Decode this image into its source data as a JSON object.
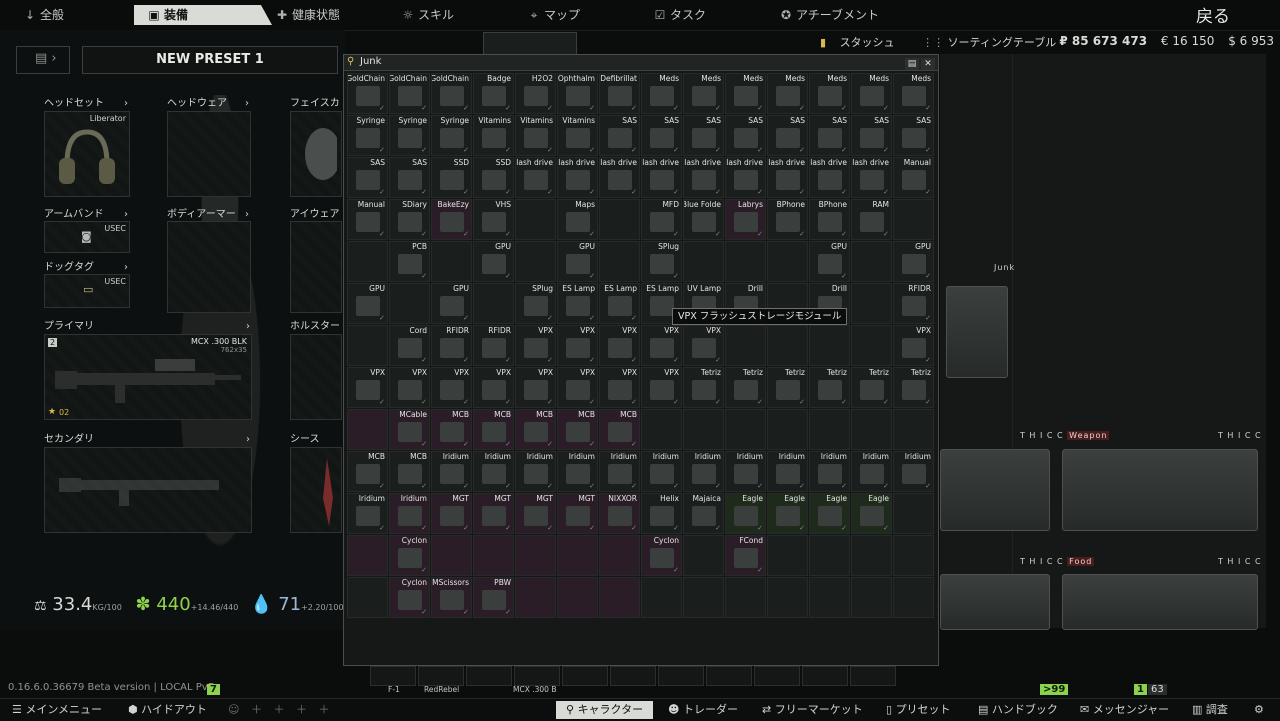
{
  "nav": {
    "tabs": [
      {
        "icon": "↓",
        "label": "全般"
      },
      {
        "icon": "▣",
        "label": "装備"
      },
      {
        "icon": "✚",
        "label": "健康状態"
      },
      {
        "icon": "☼",
        "label": "スキル"
      },
      {
        "icon": "⌖",
        "label": "マップ"
      },
      {
        "icon": "☑",
        "label": "タスク"
      },
      {
        "icon": "✪",
        "label": "アチーブメント"
      }
    ],
    "back": "戻る"
  },
  "sub_tabs": [
    "スタッシュ",
    "ソーティングテーブル"
  ],
  "currency": {
    "rub": "₽ 85 673 473",
    "eur": "€ 16 150",
    "usd": "$ 6 953"
  },
  "preset": {
    "name": "NEW PRESET 1"
  },
  "slots": {
    "headset": {
      "label": "ヘッドセット",
      "tag": "Liberator"
    },
    "headwear": {
      "label": "ヘッドウェア"
    },
    "facecover": {
      "label": "フェイスカ"
    },
    "armband": {
      "label": "アームバンド",
      "tag": "USEC"
    },
    "armor": {
      "label": "ボディアーマー"
    },
    "eyewear": {
      "label": "アイウェア"
    },
    "dogtag": {
      "label": "ドッグタグ",
      "tag": "USEC"
    },
    "primary": {
      "label": "プライマリ",
      "weapon": "MCX .300 BLK",
      "ammo": "762x35",
      "num": "2",
      "level": "02"
    },
    "holster": {
      "label": "ホルスター"
    },
    "secondary": {
      "label": "セカンダリ"
    },
    "scabbard": {
      "label": "シース"
    }
  },
  "stats": {
    "weight": "33.4",
    "weight_unit": "KG",
    "weight_max": "/100",
    "energy": "440",
    "energy_rate": "+14.46",
    "energy_max": "/440",
    "hydration": "71",
    "hydration_rate": "+2.20",
    "hydration_max": "/100",
    "stamina": "04"
  },
  "junk": {
    "title": "Junk",
    "rows": [
      [
        "GoldChain",
        "GoldChain",
        "GoldChain",
        "Badge",
        "H2O2",
        "Ophthalm",
        "Defibrillat",
        "Meds",
        "Meds",
        "Meds",
        "Meds",
        "Meds",
        "Meds",
        "Meds"
      ],
      [
        "Syringe",
        "Syringe",
        "Syringe",
        "Vitamins",
        "Vitamins",
        "Vitamins",
        "SAS",
        "SAS",
        "SAS",
        "SAS",
        "SAS",
        "SAS",
        "SAS",
        "SAS"
      ],
      [
        "SAS",
        "SAS",
        "SSD",
        "SSD",
        "Flash drive",
        "Flash drive",
        "Flash drive",
        "Flash drive",
        "Flash drive",
        "Flash drive",
        "Flash drive",
        "Flash drive",
        "Flash drive",
        "Manual"
      ],
      [
        "Manual",
        "SDiary",
        "BakeEzy",
        "VHS",
        "",
        "Maps",
        "",
        "MFD",
        "Blue Folde",
        "Labrys",
        "BPhone",
        "BPhone",
        "RAM",
        ""
      ],
      [
        "",
        "PCB",
        "",
        "GPU",
        "",
        "GPU",
        "",
        "SPlug",
        "",
        "",
        "",
        "GPU",
        "",
        "GPU"
      ],
      [
        "GPU",
        "",
        "GPU",
        "",
        "SPlug",
        "ES Lamp",
        "ES Lamp",
        "ES Lamp",
        "UV Lamp",
        "Drill",
        "",
        "Drill",
        "",
        "RFIDR"
      ],
      [
        "",
        "Cord",
        "RFIDR",
        "RFIDR",
        "VPX",
        "VPX",
        "VPX",
        "VPX",
        "VPX",
        "",
        "",
        "",
        "",
        "VPX"
      ],
      [
        "VPX",
        "VPX",
        "VPX",
        "VPX",
        "VPX",
        "VPX",
        "VPX",
        "VPX",
        "Tetriz",
        "Tetriz",
        "Tetriz",
        "Tetriz",
        "Tetriz",
        "Tetriz"
      ],
      [
        "",
        "MCable",
        "MCB",
        "MCB",
        "MCB",
        "MCB",
        "MCB",
        "",
        "",
        "",
        "",
        "",
        "",
        ""
      ],
      [
        "MCB",
        "MCB",
        "Iridium",
        "Iridium",
        "Iridium",
        "Iridium",
        "Iridium",
        "Iridium",
        "Iridium",
        "Iridium",
        "Iridium",
        "Iridium",
        "Iridium",
        "Iridium"
      ],
      [
        "Iridium",
        "Iridium",
        "MGT",
        "MGT",
        "MGT",
        "MGT",
        "NIXXOR",
        "Helix",
        "Majaica",
        "Eagle",
        "Eagle",
        "Eagle",
        "Eagle",
        ""
      ],
      [
        "",
        "Cyclon",
        "",
        "",
        "",
        "",
        "",
        "Cyclon",
        "",
        "FCond",
        "",
        "",
        "",
        ""
      ],
      [
        "",
        "Cyclon",
        "MScissors",
        "PBW",
        "",
        "",
        "",
        "",
        "",
        "",
        "",
        "",
        "",
        ""
      ]
    ]
  },
  "tooltip": "VPX フラッシュストレージモジュール",
  "stash": {
    "junk_label": "Junk",
    "thicc": "T H I C C",
    "weapon": "Weapon",
    "food": "Food"
  },
  "version": "0.16.6.0.36679 Beta version | LOCAL PvE",
  "quickbar": {
    "labels": [
      "F-1",
      "RedRebel",
      "MCX .300 B"
    ]
  },
  "bottom": {
    "left": [
      "メインメニュー",
      "ハイドアウト"
    ],
    "right": [
      "キャラクター",
      "トレーダー",
      "フリーマーケット",
      "プリセット",
      "ハンドブック",
      "メッセンジャー",
      "調査"
    ],
    "badges": {
      "green99": ">99",
      "one": "1",
      "count63": "63",
      "seven": "7"
    }
  }
}
